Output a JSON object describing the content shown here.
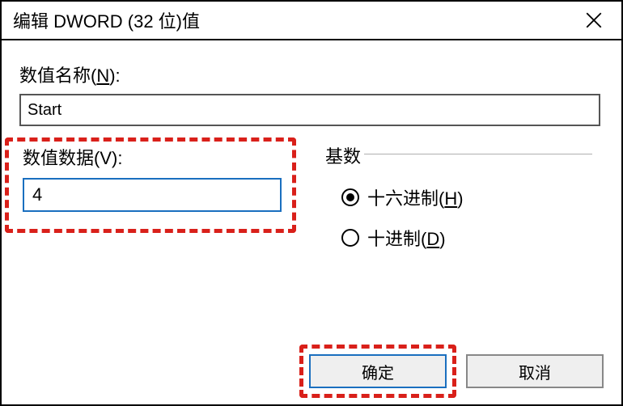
{
  "window": {
    "title": "编辑 DWORD (32 位)值"
  },
  "value_name": {
    "label_prefix": "数值名称(",
    "label_key": "N",
    "label_suffix": "):",
    "value": "Start"
  },
  "value_data": {
    "label_prefix": "数值数据(",
    "label_key": "V",
    "label_suffix": "):",
    "value": "4"
  },
  "base": {
    "legend": "基数",
    "hex_prefix": "十六进制(",
    "hex_key": "H",
    "hex_suffix": ")",
    "dec_prefix": "十进制(",
    "dec_key": "D",
    "dec_suffix": ")"
  },
  "buttons": {
    "ok": "确定",
    "cancel": "取消"
  }
}
